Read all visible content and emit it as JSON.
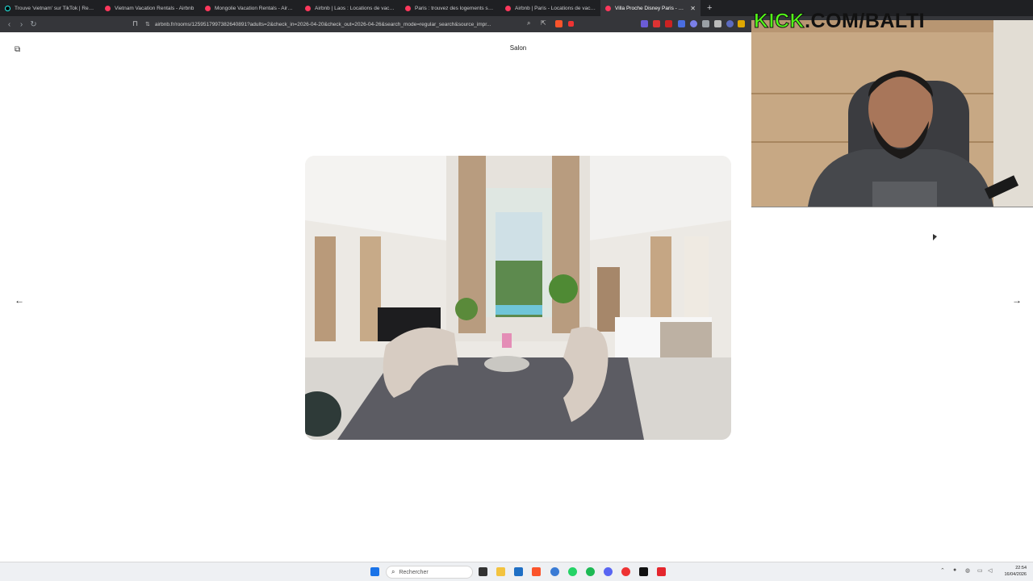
{
  "browser": {
    "tabs": [
      {
        "label": "Trouve 'vietnam' sur TikTok | Recherc",
        "icon": "tiktok-icon"
      },
      {
        "label": "Vietnam Vacation Rentals - Airbnb",
        "icon": "airbnb-icon"
      },
      {
        "label": "Mongolie Vacation Rentals - Airbnb",
        "icon": "airbnb-icon"
      },
      {
        "label": "Airbnb | Laos : Locations de vacance",
        "icon": "airbnb-icon"
      },
      {
        "label": "Paris : trouvez des logements sur Air",
        "icon": "airbnb-icon"
      },
      {
        "label": "Airbnb | Paris - Locations de vacance",
        "icon": "airbnb-icon"
      },
      {
        "label": "Villa Proche Disney Paris - Maiso",
        "icon": "airbnb-icon",
        "active": true
      }
    ],
    "close_glyph": "✕",
    "new_tab_glyph": "+",
    "url": "airbnb.fr/rooms/1259517997382640891?adults=2&check_in=2026-04-20&check_out=2026-04-26&search_mode=regular_search&source_impr..."
  },
  "page": {
    "photo_title": "Salon",
    "prev_arrow": "←",
    "next_arrow": "→"
  },
  "overlay": {
    "kick_text": "KICK",
    "banner_rest": ".COM/BALTI"
  },
  "taskbar": {
    "search_placeholder": "Rechercher",
    "time": "22:54",
    "date": "16/04/2026"
  },
  "colors": {
    "airbnb": "#ff385c",
    "kick_green": "#53fc18",
    "tabbar_bg": "#1f2023",
    "toolbar_bg": "#35363a"
  }
}
